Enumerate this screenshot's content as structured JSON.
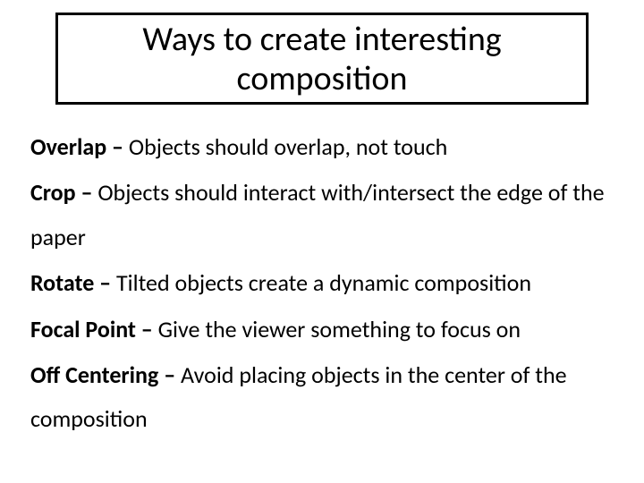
{
  "title": "Ways to create interesting composition",
  "items": [
    {
      "term": "Overlap – ",
      "desc": "Objects should overlap, not touch"
    },
    {
      "term": "Crop – ",
      "desc": "Objects should interact with/intersect the edge of the paper"
    },
    {
      "term": "Rotate – ",
      "desc": "Tilted objects create a dynamic composition"
    },
    {
      "term": "Focal Point – ",
      "desc": "Give the viewer something to focus on"
    },
    {
      "term": "Off Centering – ",
      "desc": "Avoid placing objects in the center of the composition"
    }
  ]
}
